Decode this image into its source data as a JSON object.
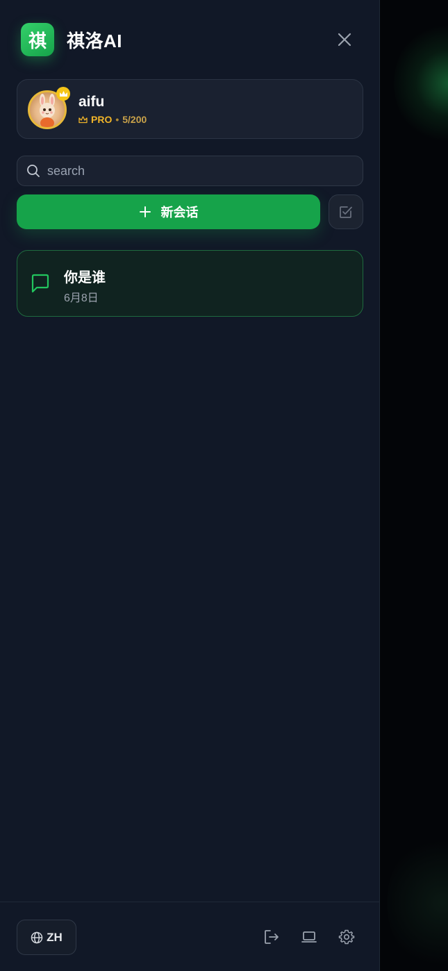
{
  "app": {
    "logo_char": "祺",
    "title": "祺洛AI"
  },
  "user": {
    "name": "aifu",
    "plan": "PRO",
    "separator": "•",
    "quota": "5/200"
  },
  "search": {
    "placeholder": "search",
    "value": ""
  },
  "actions": {
    "new_chat_label": "新会话"
  },
  "conversations": [
    {
      "title": "你是谁",
      "date": "6月8日",
      "active": true
    }
  ],
  "footer": {
    "language_label": "ZH"
  },
  "colors": {
    "accent": "#16a34a",
    "sidebar_bg": "#111827",
    "gold": "#f0b429"
  },
  "icons": [
    "close-icon",
    "crown-icon",
    "search-icon",
    "plus-icon",
    "select-check-icon",
    "chat-bubble-icon",
    "globe-icon",
    "logout-icon",
    "laptop-icon",
    "gear-icon"
  ]
}
